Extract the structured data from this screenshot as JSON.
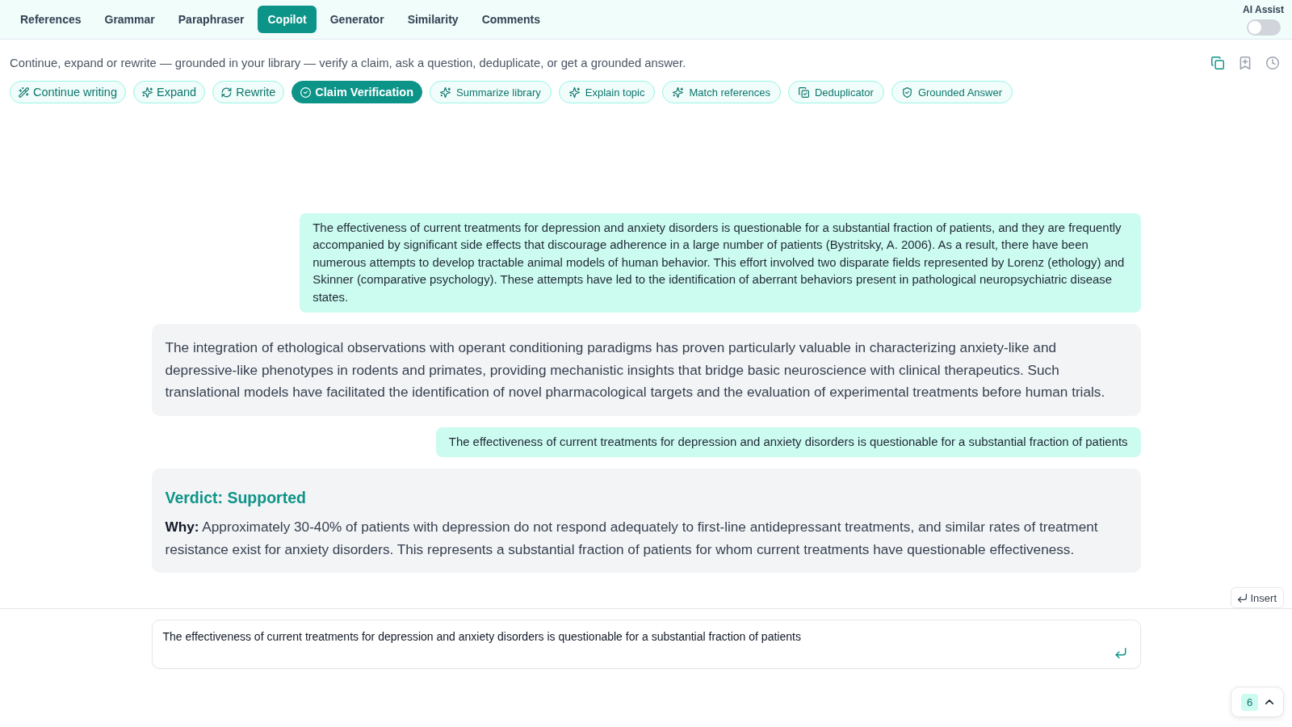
{
  "tabs": [
    {
      "label": "References",
      "selected": false
    },
    {
      "label": "Grammar",
      "selected": false
    },
    {
      "label": "Paraphraser",
      "selected": false
    },
    {
      "label": "Copilot",
      "selected": true
    },
    {
      "label": "Generator",
      "selected": false
    },
    {
      "label": "Similarity",
      "selected": false
    },
    {
      "label": "Comments",
      "selected": false
    }
  ],
  "ai_assist": {
    "label": "AI Assist",
    "on": false
  },
  "copilot": {
    "description": "Continue, expand or rewrite — grounded in your library — verify a claim, ask a question, deduplicate, or get a grounded answer.",
    "tools": [
      {
        "label": "Continue writing",
        "kind": "writing",
        "selected": false
      },
      {
        "label": "Expand",
        "kind": "writing",
        "selected": false
      },
      {
        "label": "Rewrite",
        "kind": "writing",
        "selected": false
      },
      {
        "label": "Claim Verification",
        "kind": "writing",
        "selected": true
      },
      {
        "label": "Summarize library",
        "kind": "library",
        "selected": false
      },
      {
        "label": "Explain topic",
        "kind": "library",
        "selected": false
      },
      {
        "label": "Match references",
        "kind": "library",
        "selected": false
      },
      {
        "label": "Deduplicator",
        "kind": "library",
        "selected": false
      },
      {
        "label": "Grounded Answer",
        "kind": "library",
        "selected": false
      }
    ]
  },
  "messages": [
    {
      "kind": "user",
      "text": "The effectiveness of current treatments for depression and anxiety disorders is questionable for a substantial fraction of patients, and they are frequently accompanied by significant side effects that discourage adherence in a large number of patients (Bystritsky, A. 2006). As a result, there have been numerous attempts to develop tractable animal models of human behavior. This effort involved two disparate fields represented by Lorenz (ethology) and Skinner (comparative psychology). These attempts have led to the identification of aberrant behaviors present in pathological neuropsychiatric disease states."
    },
    {
      "kind": "assistant",
      "text": "The integration of ethological observations with operant conditioning paradigms has proven particularly valuable in characterizing anxiety-like and depressive-like phenotypes in rodents and primates, providing mechanistic insights that bridge basic neuroscience with clinical therapeutics. Such translational models have facilitated the identification of novel pharmacological targets and the evaluation of experimental treatments before human trials."
    },
    {
      "kind": "user",
      "text": "The effectiveness of current treatments for depression and anxiety disorders is questionable for a substantial fraction of patients"
    },
    {
      "kind": "verdict",
      "title": "Verdict: Supported",
      "text": "**Why:** Approximately 30-40% of patients with depression do not respond adequately to first-line antidepressant treatments, and similar rates of treatment resistance exist for anxiety disorders. This represents a substantial fraction of patients for whom current treatments have questionable effectiveness."
    }
  ],
  "insert_button": {
    "label": "Insert"
  },
  "composer": {
    "value": "The effectiveness of current treatments for depression and anxiety disorders is questionable for a substantial fraction of patients"
  },
  "counter": {
    "count": "6"
  }
}
